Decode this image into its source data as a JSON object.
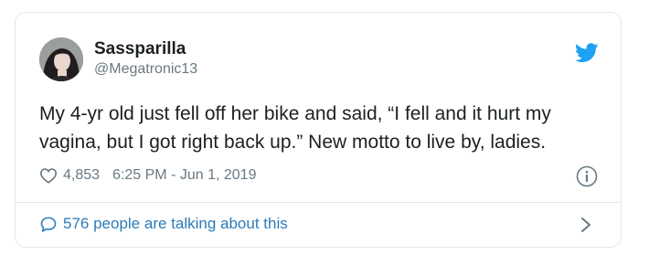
{
  "tweet": {
    "author": {
      "display_name": "Sassparilla",
      "handle": "@Megatronic13"
    },
    "text": "My 4-yr old just fell off her bike and said, “I fell and it hurt my vagina, but I got right back up.” New motto to live by, ladies.",
    "likes": "4,853",
    "timestamp": "6:25 PM - Jun 1, 2019",
    "talking_about": "576 people are talking about this"
  },
  "icons": {
    "brand": "twitter-bird-icon",
    "like": "heart-icon",
    "info": "info-icon",
    "reply": "reply-bubble-icon",
    "chevron": "chevron-right-icon"
  },
  "colors": {
    "twitter_blue": "#1da1f2",
    "link_blue": "#2b7bb9",
    "meta_gray": "#697882",
    "text": "#1c2022",
    "border": "#e1e8ed"
  }
}
